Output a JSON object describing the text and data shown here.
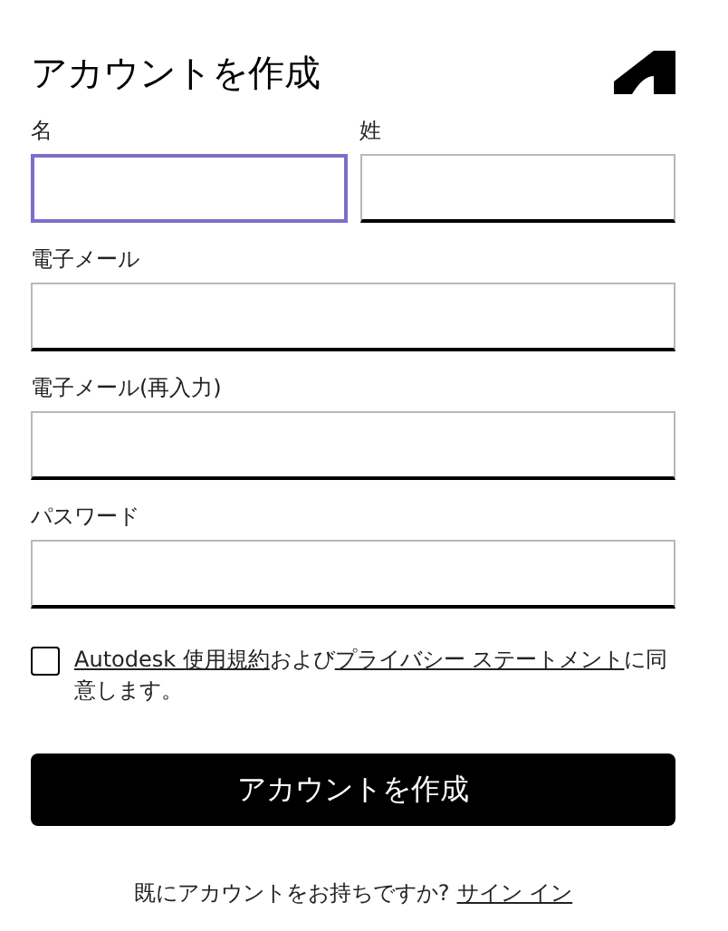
{
  "title": "アカウントを作成",
  "name_fields": [
    {
      "label": "名",
      "focused": true
    },
    {
      "label": "姓",
      "focused": false
    }
  ],
  "fields": [
    {
      "label": "電子メール",
      "focused": false
    },
    {
      "label": "電子メール(再入力)",
      "focused": false
    },
    {
      "label": "パスワード",
      "focused": false
    }
  ],
  "consent": {
    "checked": false,
    "parts": [
      {
        "kind": "link",
        "text": "Autodesk 使用規約"
      },
      {
        "kind": "text",
        "text": "および"
      },
      {
        "kind": "link",
        "text": "プライバシー ステートメント"
      },
      {
        "kind": "text",
        "text": "に同意します。"
      }
    ]
  },
  "submit_button": "アカウントを作成",
  "footer": {
    "text": "既にアカウントをお持ちですか?",
    "link": "サイン イン"
  }
}
